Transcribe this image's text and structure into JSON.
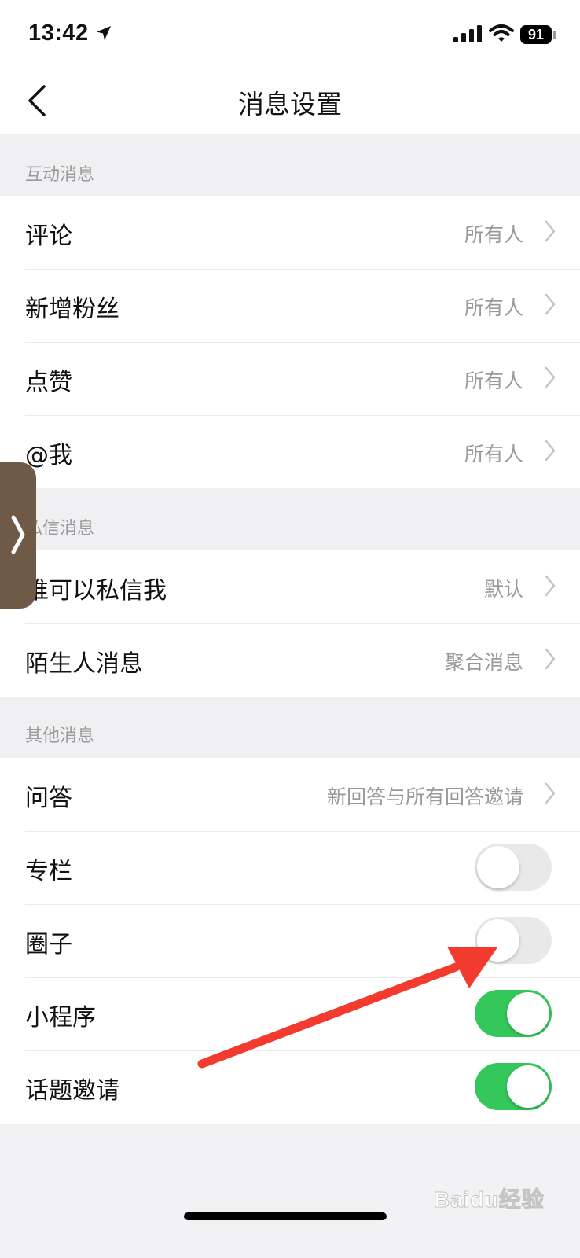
{
  "status_bar": {
    "time": "13:42",
    "battery": "91"
  },
  "header": {
    "title": "消息设置"
  },
  "sections": [
    {
      "label": "互动消息",
      "rows": [
        {
          "label": "评论",
          "value": "所有人"
        },
        {
          "label": "新增粉丝",
          "value": "所有人"
        },
        {
          "label": "点赞",
          "value": "所有人"
        },
        {
          "label": "@我",
          "value": "所有人"
        }
      ]
    },
    {
      "label": "私信消息",
      "rows": [
        {
          "label": "谁可以私信我",
          "value": "默认"
        },
        {
          "label": "陌生人消息",
          "value": "聚合消息"
        }
      ]
    },
    {
      "label": "其他消息",
      "rows": [
        {
          "label": "问答",
          "value": "新回答与所有回答邀请"
        },
        {
          "label": "专栏",
          "toggle": false
        },
        {
          "label": "圈子",
          "toggle": false
        },
        {
          "label": "小程序",
          "toggle": true
        },
        {
          "label": "话题邀请",
          "toggle": true
        }
      ]
    }
  ],
  "watermark": "Baidu经验",
  "colors": {
    "toggle_on": "#34c759",
    "toggle_off": "#e9e9ea",
    "annotation_arrow": "#f23a2e"
  }
}
